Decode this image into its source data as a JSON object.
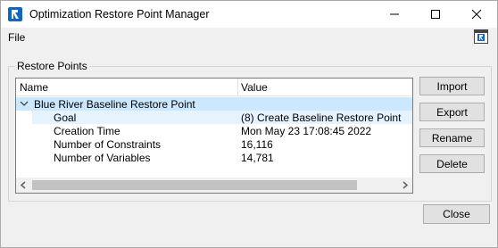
{
  "window": {
    "title": "Optimization Restore Point Manager",
    "controls": {
      "minimize": "minimize",
      "maximize": "maximize",
      "close": "close"
    }
  },
  "menu": {
    "file": "File"
  },
  "restore_points": {
    "group_label": "Restore Points",
    "columns": {
      "name": "Name",
      "value": "Value"
    },
    "parent": {
      "name": "Blue River Baseline Restore Point"
    },
    "rows": [
      {
        "name": "Goal",
        "value": "(8) Create Baseline Restore Point"
      },
      {
        "name": "Creation Time",
        "value": "Mon May 23 17:08:45 2022"
      },
      {
        "name": "Number of Constraints",
        "value": "16,116"
      },
      {
        "name": "Number of Variables",
        "value": "14,781"
      }
    ]
  },
  "buttons": {
    "import": "Import",
    "export": "Export",
    "rename": "Rename",
    "delete": "Delete",
    "close": "Close"
  },
  "colors": {
    "accent": "#1565c0",
    "selection": "#cce8ff",
    "row_band": "#e5f3ff"
  },
  "icons": {
    "app": "riverware-app-icon",
    "help": "context-help-icon",
    "expand": "chevron-down-icon"
  }
}
